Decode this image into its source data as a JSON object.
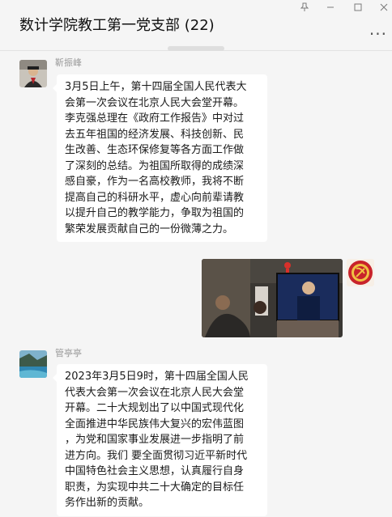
{
  "window": {
    "title": "数计学院教工第一党支部 (22)",
    "pin_icon": "pin-icon",
    "minimize_icon": "minimize-icon",
    "maximize_icon": "maximize-icon",
    "close_icon": "close-icon",
    "more_icon": "more-icon"
  },
  "messages": [
    {
      "sender": "靳振峰",
      "avatar_icon": "avatar-person-photo",
      "text": "3月5日上午，第十四届全国人民代表大\n会第一次会议在北京人民大会堂开幕。\n李克强总理在《政府工作报告》中对过\n去五年祖国的经济发展、科技创新、民\n生改善、生态环保修复等各方面工作做\n了深刻的总结。为祖国所取得的成绩深\n感自豪，作为一名高校教师，我将不断\n提高自己的科研水平，虚心向前辈请教\n以提升自己的教学能力，争取为祖国的\n繁荣发展贡献自己的一份微薄之力。"
    },
    {
      "sender": "",
      "avatar_icon": "party-emblem-avatar",
      "image_icon": "photo-watching-tv"
    },
    {
      "sender": "管亭亭",
      "avatar_icon": "avatar-landscape-photo",
      "text": "2023年3月5日9时，第十四届全国人民\n代表大会第一次会议在北京人民大会堂\n开幕。二十大规划出了以中国式现代化\n全面推进中华民族伟大复兴的宏伟蓝图\n，为党和国家事业发展进一步指明了前\n进方向。我们 要全面贯彻习近平新时代\n中国特色社会主义思想，认真履行自身\n职责，为实现中共二十大确定的目标任\n务作出新的贡献。"
    }
  ],
  "colors": {
    "background": "#f5f5f5",
    "bubble": "#ffffff",
    "sender_name": "#9a9a9a"
  }
}
